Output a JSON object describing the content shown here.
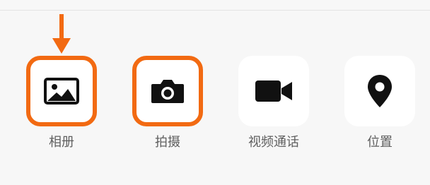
{
  "panel": {
    "items": [
      {
        "key": "album",
        "label": "相册",
        "icon": "image-icon",
        "highlighted": true
      },
      {
        "key": "camera",
        "label": "拍摄",
        "icon": "camera-icon",
        "highlighted": true
      },
      {
        "key": "video-call",
        "label": "视频通话",
        "icon": "video-camera-icon",
        "highlighted": false
      },
      {
        "key": "location",
        "label": "位置",
        "icon": "location-pin-icon",
        "highlighted": false
      }
    ]
  },
  "annotation": {
    "arrow_icon": "down-arrow-icon",
    "color": "#f26a12"
  },
  "colors": {
    "background": "#f7f7f7",
    "tile": "#ffffff",
    "icon": "#111111",
    "label": "#5f5f5f",
    "highlight": "#f26a12"
  }
}
